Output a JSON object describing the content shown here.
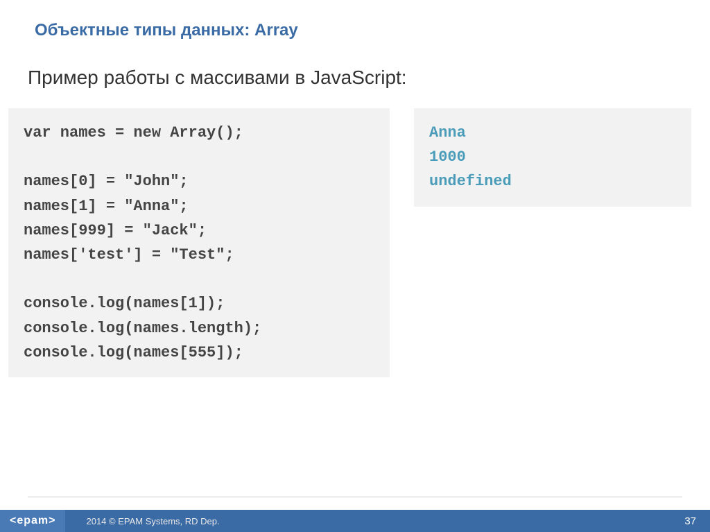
{
  "title": "Объектные типы данных: Array",
  "subtitle": "Пример работы с массивами в JavaScript:",
  "code": "var names = new Array();\n\nnames[0] = \"John\";\nnames[1] = \"Anna\";\nnames[999] = \"Jack\";\nnames['test'] = \"Test\";\n\nconsole.log(names[1]);\nconsole.log(names.length);\nconsole.log(names[555]);",
  "output": "Anna\n1000\nundefined",
  "footer": {
    "logo": "<epam>",
    "copyright": "2014 © EPAM Systems, RD Dep.",
    "page": "37"
  }
}
